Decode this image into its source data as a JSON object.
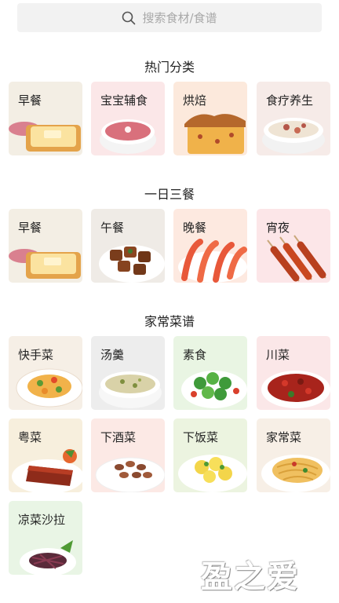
{
  "search": {
    "placeholder": "搜索食材/食谱",
    "icon": "search-icon"
  },
  "sections": [
    {
      "title": "热门分类",
      "items": [
        {
          "label": "早餐",
          "bg": "#f3eee4",
          "icon": "toast-icon"
        },
        {
          "label": "宝宝辅食",
          "bg": "#fbe7e8",
          "icon": "porridge-bowl-icon"
        },
        {
          "label": "烘焙",
          "bg": "#fce9dc",
          "icon": "cake-icon"
        },
        {
          "label": "食疗养生",
          "bg": "#f6ebe8",
          "icon": "soup-bowl-icon"
        }
      ]
    },
    {
      "title": "一日三餐",
      "items": [
        {
          "label": "早餐",
          "bg": "#f3eee4",
          "icon": "toast-icon"
        },
        {
          "label": "午餐",
          "bg": "#efebe6",
          "icon": "braised-meat-icon"
        },
        {
          "label": "晚餐",
          "bg": "#fde9e0",
          "icon": "shrimp-icon"
        },
        {
          "label": "宵夜",
          "bg": "#fce6e8",
          "icon": "skewers-icon"
        }
      ]
    },
    {
      "title": "家常菜谱",
      "items": [
        {
          "label": "快手菜",
          "bg": "#f6efe6",
          "icon": "stir-fry-plate-icon"
        },
        {
          "label": "汤羹",
          "bg": "#ededed",
          "icon": "soup-bowl-icon"
        },
        {
          "label": "素食",
          "bg": "#e9f5e3",
          "icon": "salad-icon"
        },
        {
          "label": "川菜",
          "bg": "#fbe7e8",
          "icon": "chili-dish-icon"
        },
        {
          "label": "粤菜",
          "bg": "#f7efdd",
          "icon": "roast-duck-icon"
        },
        {
          "label": "下酒菜",
          "bg": "#fce9e5",
          "icon": "peanut-bowl-icon"
        },
        {
          "label": "下饭菜",
          "bg": "#ecf4e0",
          "icon": "egg-stir-fry-icon"
        },
        {
          "label": "家常菜",
          "bg": "#f7efe6",
          "icon": "noodle-plate-icon"
        },
        {
          "label": "凉菜沙拉",
          "bg": "#e9f5e5",
          "icon": "cold-salad-icon"
        }
      ]
    }
  ],
  "watermark": "盈之爱"
}
